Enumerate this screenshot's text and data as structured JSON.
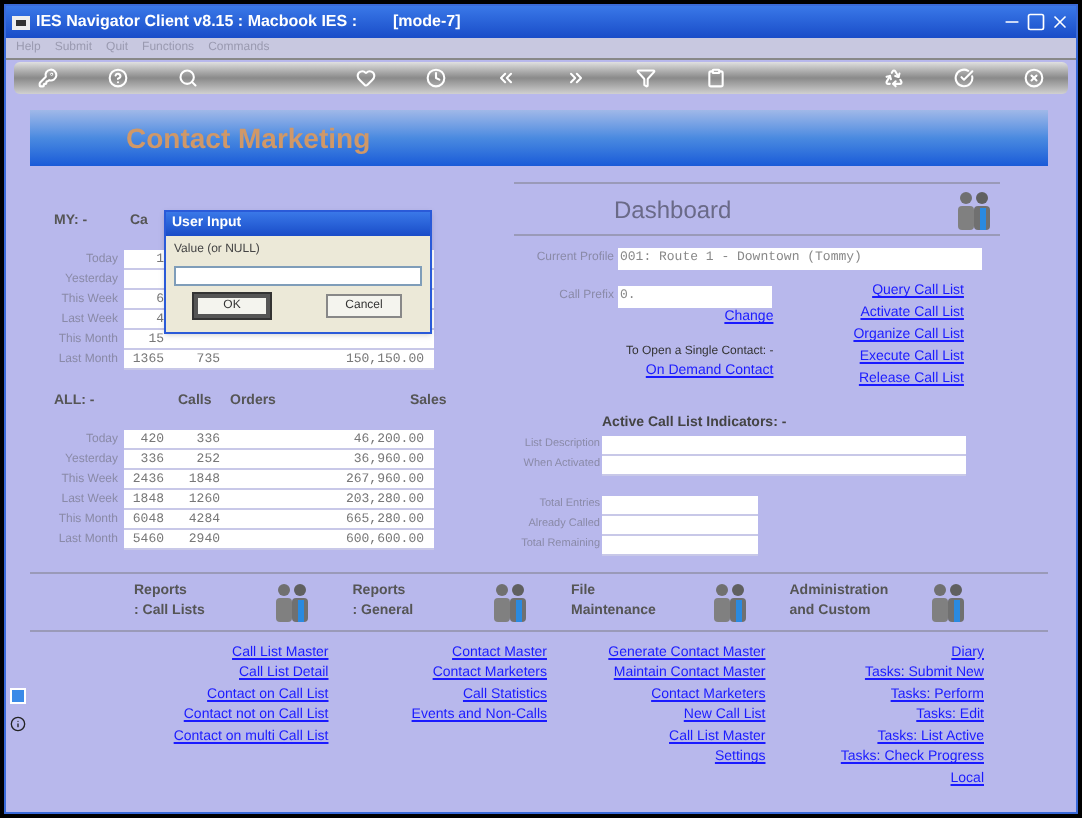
{
  "window": {
    "title": "IES Navigator Client v8.15 : Macbook IES :",
    "mode": "[mode-7]"
  },
  "menu": [
    "Help",
    "Submit",
    "Quit",
    "Functions",
    "Commands"
  ],
  "header": {
    "title": "Contact Marketing"
  },
  "my": {
    "label": "MY: -",
    "columns": [
      "Ca"
    ],
    "rows": [
      {
        "label": "Today",
        "values": [
          "1"
        ]
      },
      {
        "label": "Yesterday"
      },
      {
        "label": "This Week",
        "values": [
          "6"
        ]
      },
      {
        "label": "Last Week",
        "values": [
          "4"
        ]
      },
      {
        "label": "This Month",
        "values": [
          "15"
        ]
      },
      {
        "label": "Last Month",
        "values": [
          "1365",
          "735",
          "150,150.00"
        ]
      }
    ]
  },
  "dialog": {
    "title": "User Input",
    "label": "Value (or NULL)",
    "buttons": [
      {
        "label": "OK",
        "selected": true
      },
      {
        "label": "Cancel",
        "selected": false
      }
    ]
  },
  "dashboard": {
    "title": "Dashboard",
    "fields": [
      {
        "label": "Current Profile",
        "value": "001: Route 1 - Downtown (Tommy)"
      },
      {
        "label": "Call Prefix",
        "value": "0."
      }
    ],
    "change_link": "Change",
    "single_contact_text": "To Open a Single Contact: -",
    "on_demand_link": "On Demand Contact",
    "links": [
      "Query Call List",
      "Activate Call List",
      "Organize Call List",
      "Execute Call List",
      "Release Call List"
    ]
  },
  "all": {
    "label": "ALL: -",
    "columns": [
      "Calls",
      "Orders",
      "Sales"
    ],
    "rows": [
      {
        "label": "Today",
        "values": [
          "420",
          "336",
          "46,200.00"
        ]
      },
      {
        "label": "Yesterday",
        "values": [
          "336",
          "252",
          "36,960.00"
        ]
      },
      {
        "label": "This Week",
        "values": [
          "2436",
          "1848",
          "267,960.00"
        ]
      },
      {
        "label": "Last Week",
        "values": [
          "1848",
          "1260",
          "203,280.00"
        ]
      },
      {
        "label": "This Month",
        "values": [
          "6048",
          "4284",
          "665,280.00"
        ]
      },
      {
        "label": "Last Month",
        "values": [
          "5460",
          "2940",
          "600,600.00"
        ]
      }
    ]
  },
  "indicators": {
    "title": "Active Call List Indicators: -",
    "fields": [
      {
        "label": "List Description",
        "kind": "wide"
      },
      {
        "label": "When Activated",
        "kind": "wide"
      },
      {
        "label": "Total Entries",
        "kind": "narrow"
      },
      {
        "label": "Already Called",
        "kind": "narrow"
      },
      {
        "label": "Total Remaining",
        "kind": "narrow"
      }
    ]
  },
  "sections": [
    {
      "title": "Reports",
      "subtitle": ": Call Lists",
      "links": [
        "Call List Master",
        "Call List Detail",
        "Contact on Call List",
        "Contact not on Call List",
        "Contact on multi Call List"
      ]
    },
    {
      "title": "Reports",
      "subtitle": ": General",
      "links": [
        "Contact Master",
        "Contact Marketers",
        "Call Statistics",
        "Events and Non-Calls"
      ]
    },
    {
      "title": "File",
      "subtitle": "Maintenance",
      "links": [
        "Generate Contact Master",
        "Maintain Contact Master",
        "Contact Marketers",
        "New Call List",
        "Call List Master",
        "Settings"
      ]
    },
    {
      "title": "Administration",
      "subtitle": "and Custom",
      "links": [
        "Diary",
        "Tasks: Submit New",
        "Tasks: Perform",
        "Tasks: Edit",
        "Tasks: List Active",
        "Tasks: Check Progress",
        "Local"
      ]
    }
  ]
}
